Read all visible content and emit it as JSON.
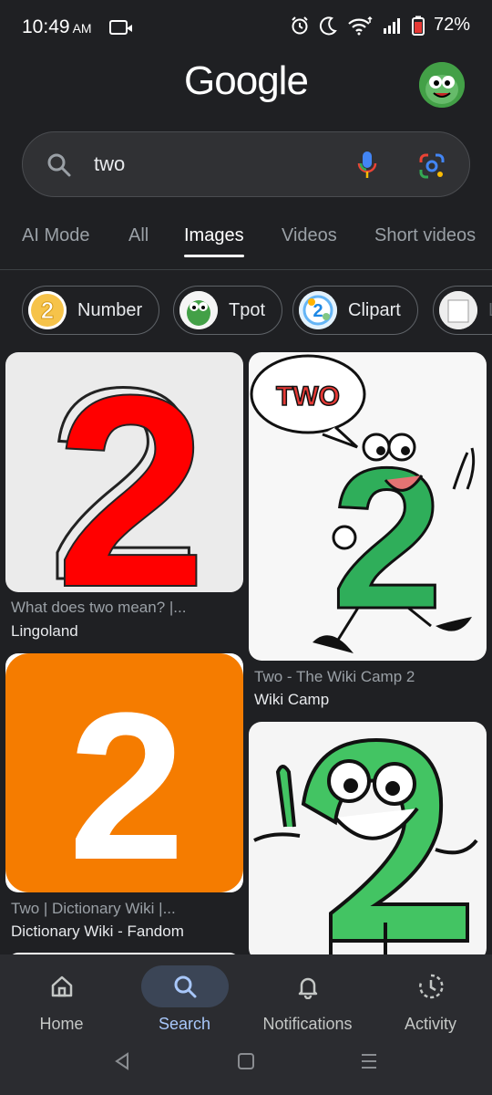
{
  "status_bar": {
    "time": "10:49",
    "ampm": "AM",
    "battery": "72%"
  },
  "header": {
    "logo": "Google"
  },
  "search": {
    "query": "two"
  },
  "tabs": [
    {
      "label": "AI Mode"
    },
    {
      "label": "All"
    },
    {
      "label": "Images"
    },
    {
      "label": "Videos"
    },
    {
      "label": "Short videos"
    }
  ],
  "chips": [
    {
      "label": "Number"
    },
    {
      "label": "Tpot"
    },
    {
      "label": "Clipart"
    },
    {
      "label": "L"
    }
  ],
  "results": [
    {
      "caption": "What does two mean? |...",
      "source": "Lingoland"
    },
    {
      "caption": "Two - The Wiki Camp 2",
      "source": "Wiki Camp",
      "speech": "TWO"
    },
    {
      "caption": "Two | Dictionary Wiki |...",
      "source": "Dictionary Wiki - Fandom"
    },
    {
      "caption": "",
      "source": ""
    }
  ],
  "digit": "2",
  "bottom_nav": [
    {
      "label": "Home",
      "icon": "home-icon"
    },
    {
      "label": "Search",
      "icon": "search-icon"
    },
    {
      "label": "Notifications",
      "icon": "bell-icon"
    },
    {
      "label": "Activity",
      "icon": "activity-icon"
    }
  ],
  "colors": {
    "background": "#1f2023",
    "accent": "#a8c7fa",
    "red2": "#ff0000",
    "orange": "#f57c00",
    "green": "#2fae5a"
  }
}
